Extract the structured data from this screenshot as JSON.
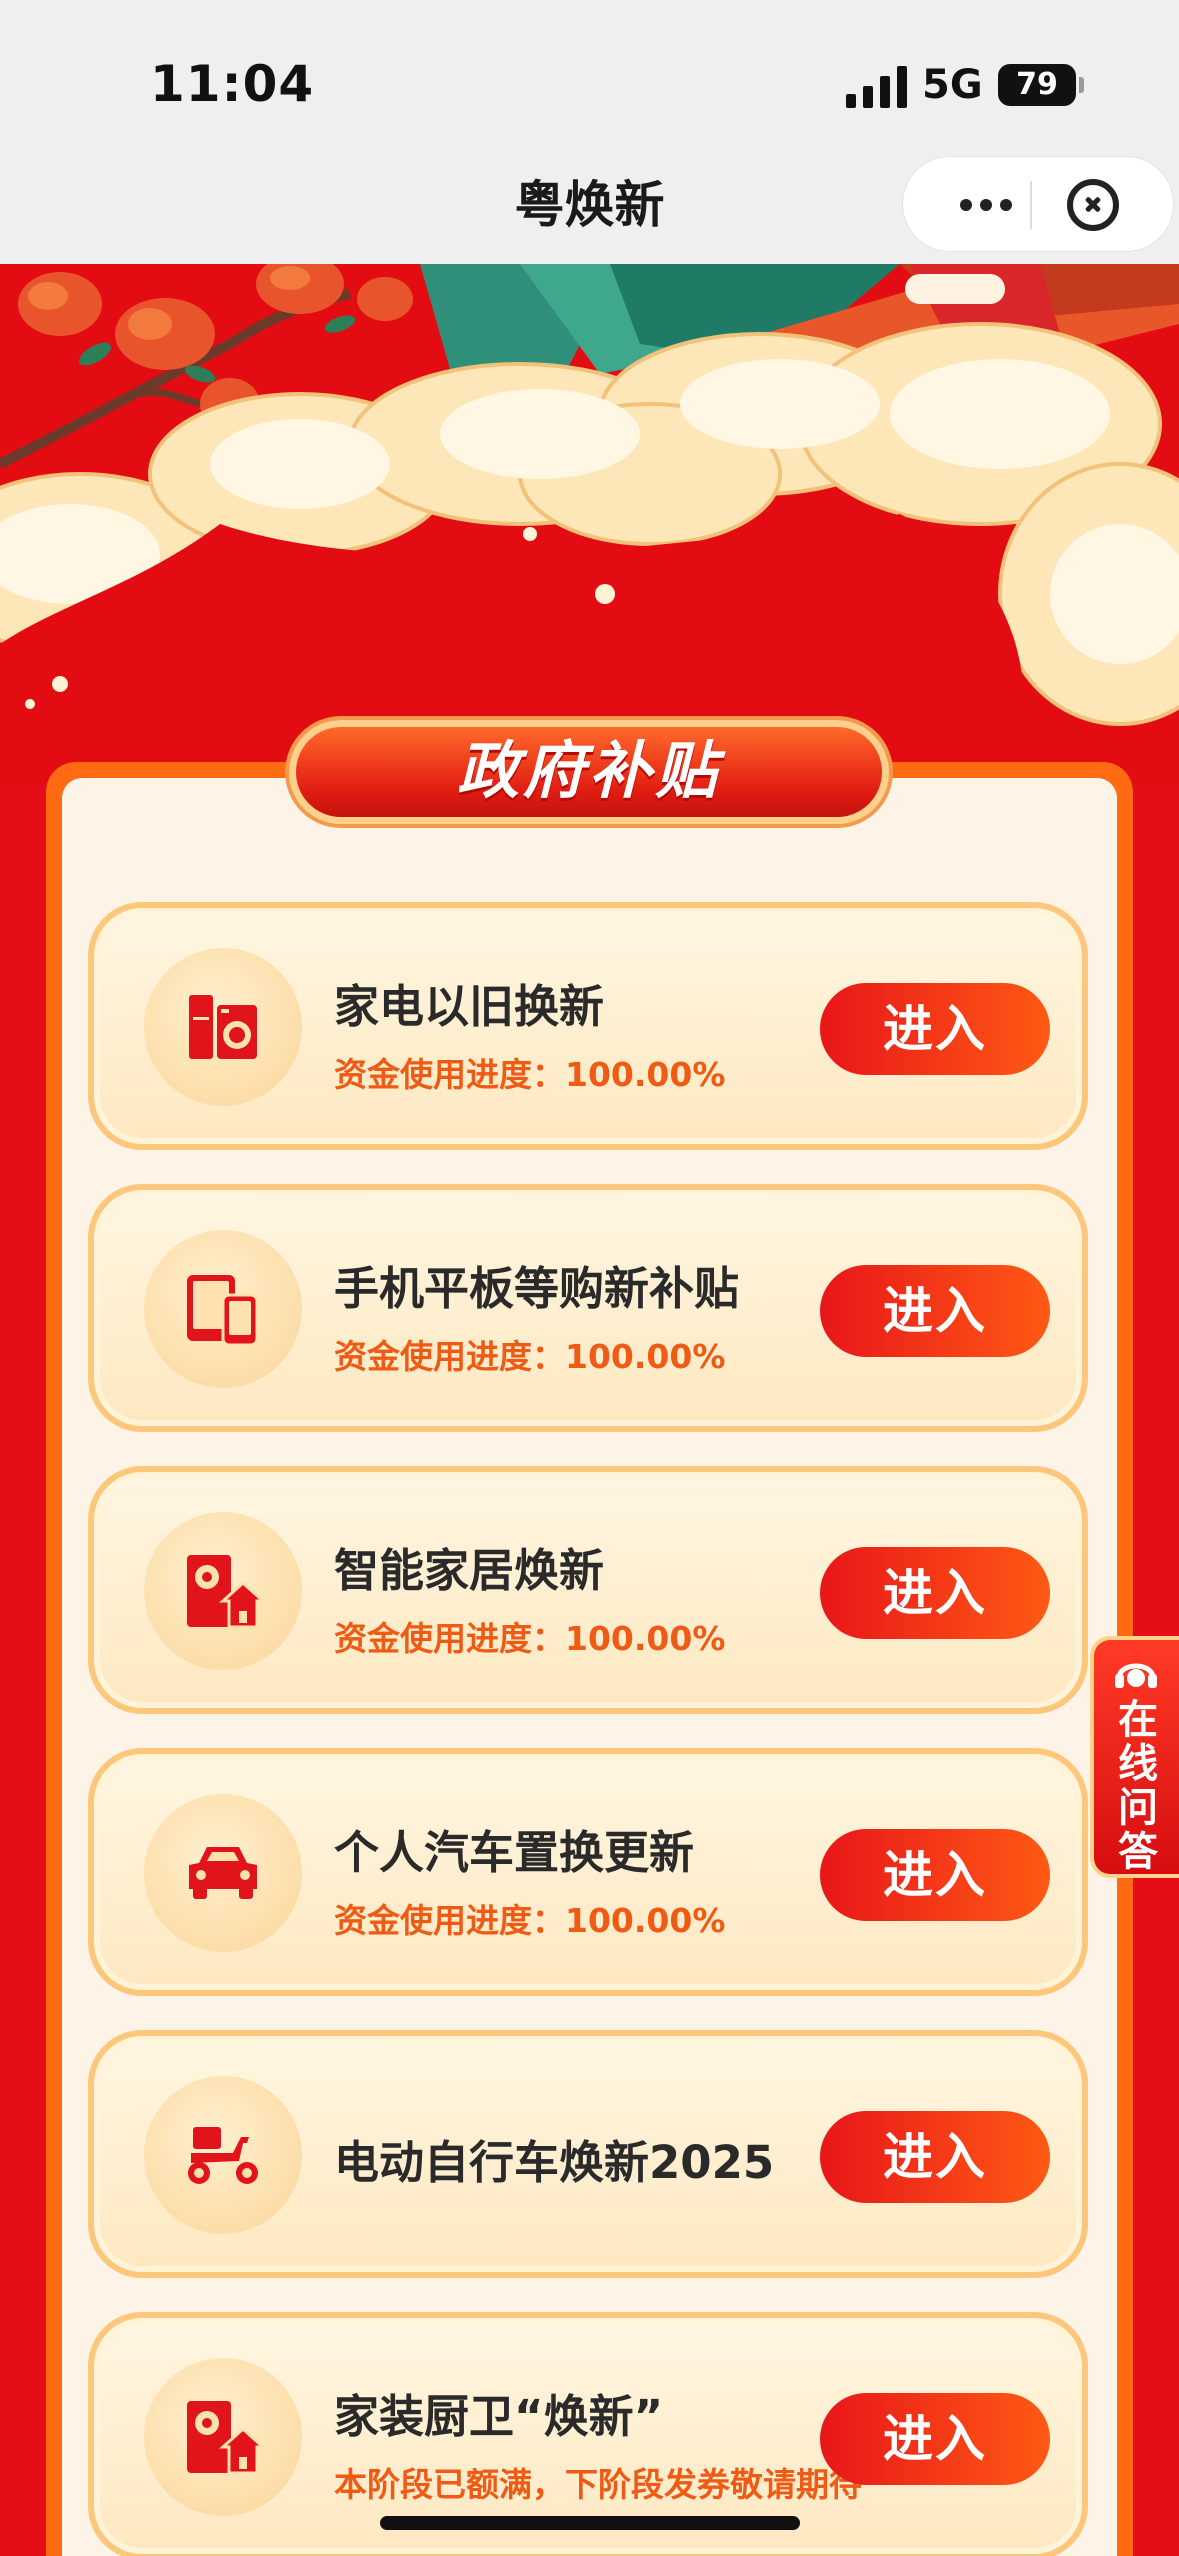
{
  "status_bar": {
    "time": "11:04",
    "network": "5G",
    "battery": "79"
  },
  "navbar": {
    "title": "粤焕新"
  },
  "section": {
    "title": "政府补贴"
  },
  "cards": [
    {
      "title": "家电以旧换新",
      "progress": "资金使用进度：100.00%",
      "button": "进入",
      "icon": "appliance-icon"
    },
    {
      "title": "手机平板等购新补贴",
      "progress": "资金使用进度：100.00%",
      "button": "进入",
      "icon": "phone-tablet-icon"
    },
    {
      "title": "智能家居焕新",
      "progress": "资金使用进度：100.00%",
      "button": "进入",
      "icon": "smart-home-icon"
    },
    {
      "title": "个人汽车置换更新",
      "progress": "资金使用进度：100.00%",
      "button": "进入",
      "icon": "car-icon"
    },
    {
      "title": "电动自行车焕新2025",
      "progress": "",
      "button": "进入",
      "icon": "scooter-icon"
    },
    {
      "title": "家装厨卫“焕新”",
      "progress": "本阶段已额满，下阶段发券敬请期待",
      "button": "进入",
      "icon": "home-kitchen-icon"
    }
  ],
  "side_tab": {
    "label": "在线问答"
  },
  "colors": {
    "primary_red": "#e50d17",
    "accent_orange": "#ef5a14",
    "card_bg": "#fff6e2"
  }
}
